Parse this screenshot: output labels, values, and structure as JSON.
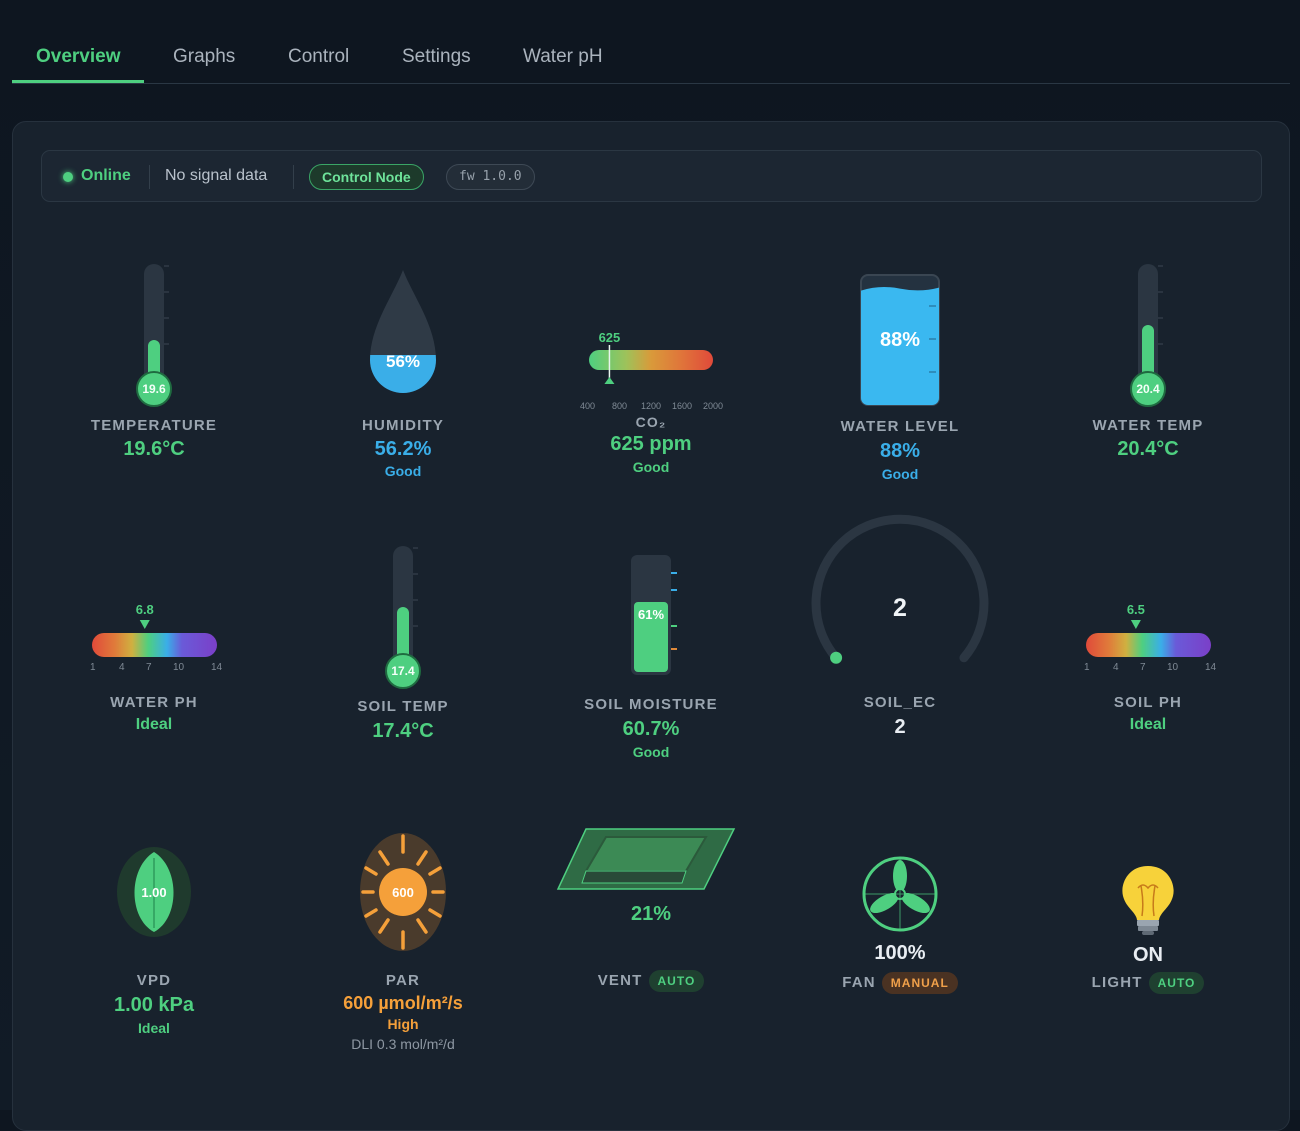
{
  "tabs": [
    {
      "label": "Overview",
      "active": true
    },
    {
      "label": "Graphs",
      "active": false
    },
    {
      "label": "Control",
      "active": false
    },
    {
      "label": "Settings",
      "active": false
    },
    {
      "label": "Water pH",
      "active": false
    }
  ],
  "status": {
    "online": "Online",
    "signal": "No signal data",
    "node": "Control Node",
    "fw": "fw 1.0.0"
  },
  "colors": {
    "accent": "#4ecf80",
    "blue": "#3aaee8",
    "orange": "#f5a03a",
    "background": "#111b26",
    "panel": "#18222d"
  },
  "widgets": {
    "temperature": {
      "label": "TEMPERATURE",
      "value": "19.6°C",
      "bulb": "19.6",
      "level": 0.36
    },
    "humidity": {
      "label": "HUMIDITY",
      "value": "56.2%",
      "status": "Good",
      "drop_text": "56%",
      "level": 0.56
    },
    "co2": {
      "label": "CO₂",
      "value": "625 ppm",
      "status": "Good",
      "marker": "625",
      "ppm": 625,
      "ticks": [
        "400",
        "800",
        "1200",
        "1600",
        "2000"
      ]
    },
    "water_level": {
      "label": "WATER LEVEL",
      "value": "88%",
      "status": "Good",
      "tank_text": "88%",
      "level": 0.88
    },
    "water_temp": {
      "label": "WATER TEMP",
      "value": "20.4°C",
      "bulb": "20.4",
      "level": 0.5
    },
    "water_ph": {
      "label": "WATER PH",
      "status": "Ideal",
      "marker": "6.8",
      "ph": 6.8,
      "ticks": [
        "1",
        "4",
        "7",
        "10",
        "14"
      ]
    },
    "soil_temp": {
      "label": "SOIL TEMP",
      "value": "17.4°C",
      "bulb": "17.4",
      "level": 0.5
    },
    "soil_moisture": {
      "label": "SOIL MOISTURE",
      "value": "60.7%",
      "status": "Good",
      "bar_text": "61%",
      "level": 0.61
    },
    "soil_ec": {
      "label": "SOIL_EC",
      "value": "2",
      "gauge_text": "2"
    },
    "soil_ph": {
      "label": "SOIL PH",
      "status": "Ideal",
      "marker": "6.5",
      "ph": 6.5,
      "ticks": [
        "1",
        "4",
        "7",
        "10",
        "14"
      ]
    },
    "vpd": {
      "label": "VPD",
      "value": "1.00 kPa",
      "status": "Ideal",
      "leaf_text": "1.00"
    },
    "par": {
      "label": "PAR",
      "value": "600 µmol/m²/s",
      "status": "High",
      "dli": "DLI 0.3 mol/m²/d",
      "sun_text": "600"
    },
    "vent": {
      "label": "VENT",
      "value": "21%",
      "mode": "AUTO"
    },
    "fan": {
      "label": "FAN",
      "value": "100%",
      "mode": "MANUAL"
    },
    "light": {
      "label": "LIGHT",
      "value": "ON",
      "mode": "AUTO"
    }
  }
}
